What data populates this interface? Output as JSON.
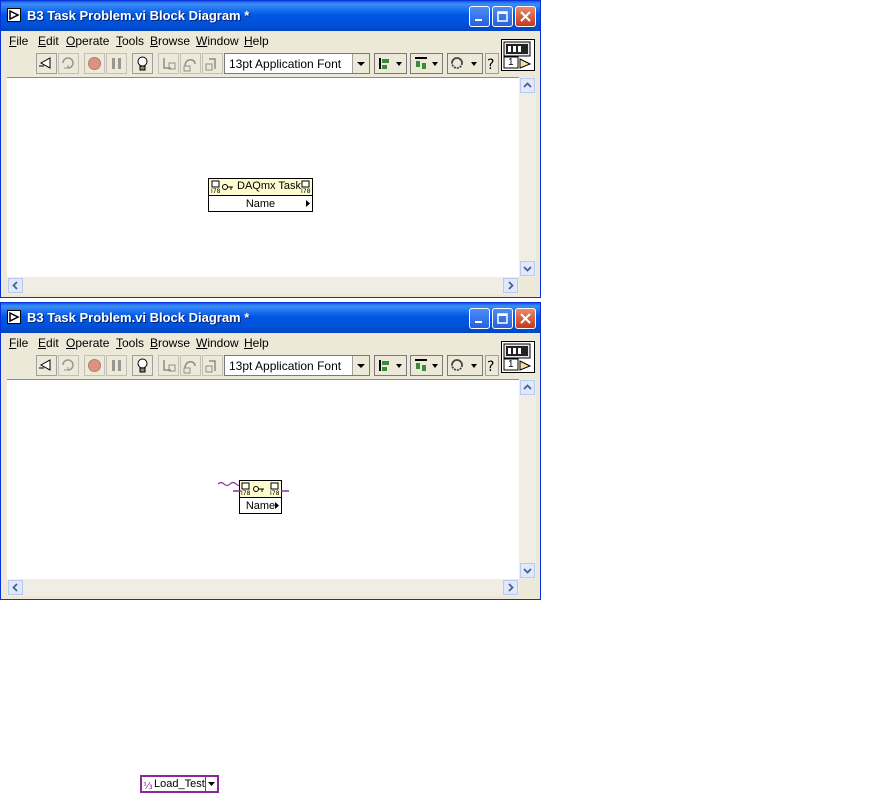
{
  "windows": [
    {
      "title": "B3 Task Problem.vi Block Diagram *",
      "node": {
        "header_label": "DAQmx Task",
        "property": "Name"
      }
    },
    {
      "title": "B3 Task Problem.vi Block Diagram *",
      "node": {
        "header_label": "",
        "property": "Name"
      },
      "constant": {
        "value": "Load_Test"
      }
    }
  ],
  "menu": {
    "file": {
      "u": "F",
      "rest": "ile"
    },
    "edit": {
      "u": "E",
      "rest": "dit"
    },
    "operate": {
      "u": "O",
      "rest": "perate"
    },
    "tools": {
      "u": "T",
      "rest": "ools"
    },
    "browse": {
      "u": "B",
      "rest": "rowse"
    },
    "window": {
      "u": "W",
      "rest": "indow"
    },
    "help": {
      "u": "H",
      "rest": "elp"
    }
  },
  "toolbar": {
    "font_selector": "13pt Application Font",
    "connector_number": "1"
  },
  "icons": [
    "run-arrow-icon",
    "run-continuously-icon",
    "abort-icon",
    "pause-icon",
    "highlight-execution-icon",
    "step-into-icon",
    "step-over-icon",
    "step-out-icon",
    "align-icon",
    "distribute-icon",
    "reorder-icon",
    "help-icon"
  ],
  "colors": {
    "title_bar": "#0058e6",
    "wire_task": "#8a2a9a",
    "node_fill": "#ffffe8"
  }
}
